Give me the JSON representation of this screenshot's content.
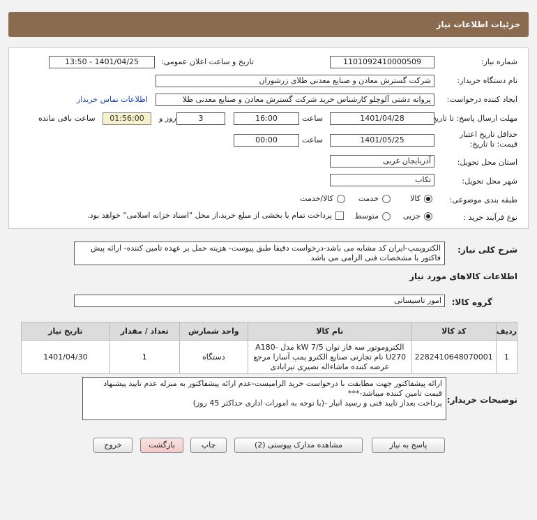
{
  "page": {
    "title": "جزئیات اطلاعات نیاز"
  },
  "form": {
    "need_number_label": "شماره نیاز:",
    "need_number": "1101092410000509",
    "announce_label": "تاریخ و ساعت اعلان عمومی:",
    "announce_value": "1401/04/25 - 13:50",
    "buyer_org_label": "نام دستگاه خریدار:",
    "buyer_org": "شرکت گسترش معادن و صنایع معدنی طلای زرشوران",
    "requester_label": "ایجاد کننده درخواست:",
    "requester": "پروانه  دشتی آلوچلو کارشناس خرید شرکت گسترش معادن و صنایع معدنی طلا",
    "contact_link": "اطلاعات تماس خریدار",
    "reply_deadline_label": "مهلت ارسال پاسخ: تا تاریخ:",
    "reply_date": "1401/04/28",
    "time_label": "ساعت",
    "reply_time": "16:00",
    "days": "3",
    "days_label": "روز و",
    "remaining": "01:56:00",
    "remaining_label": "ساعت باقی مانده",
    "validity_label_1": "حداقل تاریخ اعتبار",
    "validity_label_2": "قیمت: تا تاریخ:",
    "validity_date": "1401/05/25",
    "validity_time": "00:00",
    "province_label": "استان محل تحویل:",
    "province": "آذربایجان غربی",
    "city_label": "شهر محل تحویل:",
    "city": "تکاب",
    "category_label": "طبقه بندی موضوعی:",
    "category_options": [
      "کالا",
      "خدمت",
      "کالا/خدمت"
    ],
    "process_label": "نوع فرآیند خرید :",
    "process_options": [
      "جزیی",
      "متوسط"
    ],
    "payment_note": "پرداخت تمام یا بخشی از مبلغ خرید،از محل \"اسناد خزانه اسلامی\" خواهد بود."
  },
  "summary": {
    "label": "شرح کلی نیاز:",
    "text": "الکتروپمپ-ایران کد مشابه می باشد-درخواست دقیقا طبق پیوست- هزینه حمل بر عهده تامین کننده- ارائه پیش فاکتور با مشخصات فنی الزامی می باشد"
  },
  "goods": {
    "section_title": "اطلاعات کالاهای مورد نیاز",
    "group_label": "گروه کالا:",
    "group_value": "امور تاسیساتی",
    "columns": [
      "ردیف",
      "کد کالا",
      "نام کالا",
      "واحد شمارش",
      "تعداد / مقدار",
      "تاریخ نیاز"
    ],
    "rows": [
      {
        "index": "1",
        "code": "2282410648070001",
        "name": "الکتروموتور سه فاز توان kW 7/5 مدل A180-U270 نام تجارتی صنایع الکترو پمپ آسارا مرجع عرضه کننده ماشاءاله نصیری تیرابادی",
        "unit": "دستگاه",
        "qty": "1",
        "date": "1401/04/30"
      }
    ]
  },
  "buyer_notes": {
    "label": "توضیحات خریدار:",
    "lines": [
      "ارائه پیشفاکتور جهت مطابقت با درخواست خرید الزامیست-عدم ارائه پیشفاکتور به منزله عدم تایید پیشنهاد قیمت تامین کننده میباشد-***",
      "پرداخت بعداز تایید فنی و رسید انبار -(با توجه به امورات اداری حداکثر 45 روز)"
    ]
  },
  "buttons": {
    "reply": "پاسخ به نیاز",
    "attachments": "مشاهده مدارک پیوستی (2)",
    "print": "چاپ",
    "back": "بازگشت",
    "exit": "خروج"
  }
}
